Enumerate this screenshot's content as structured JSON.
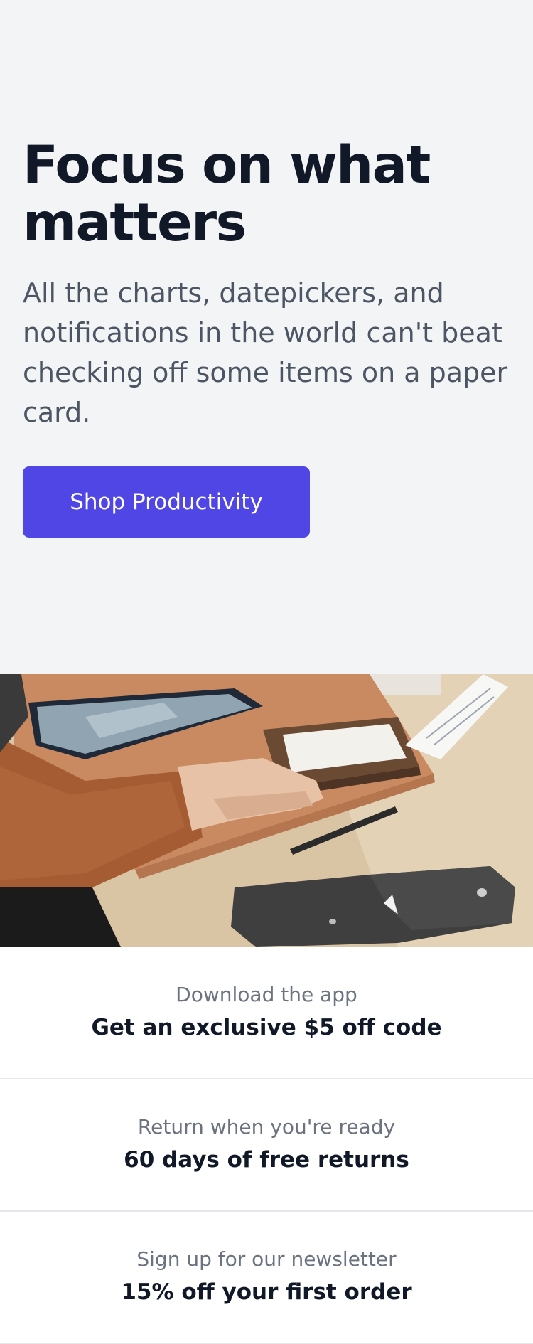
{
  "hero": {
    "title": "Focus on what matters",
    "description": "All the charts, datepickers, and notifications in the world can't beat checking off some items on a paper card.",
    "cta_label": "Shop Productivity",
    "accent_color": "#4f46e5"
  },
  "perks": [
    {
      "label": "Download the app",
      "value": "Get an exclusive $5 off code"
    },
    {
      "label": "Return when you're ready",
      "value": "60 days of free returns"
    },
    {
      "label": "Sign up for our newsletter",
      "value": "15% off your first order"
    }
  ]
}
